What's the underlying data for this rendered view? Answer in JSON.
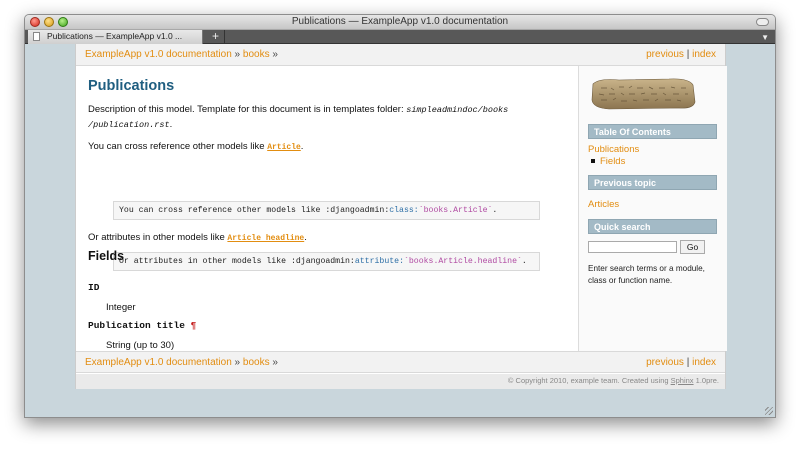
{
  "window": {
    "title": "Publications — ExampleApp v1.0 documentation"
  },
  "tab": {
    "label": "Publications — ExampleApp v1.0 ...",
    "new_tab": "+"
  },
  "relbar": {
    "home": "ExampleApp v1.0 documentation",
    "separator": "»",
    "section": "books",
    "previous": "previous",
    "pipe": "|",
    "index": "index"
  },
  "content": {
    "title": "Publications",
    "desc_text": "Description of this model. Template for this document is in templates folder: ",
    "desc_path_1": "simpleadmindoc/books",
    "desc_path_2": "/publication.rst",
    "desc_end": ".",
    "xref_text": "You can cross reference other models like ",
    "xref_link": "Article",
    "xref_end": ".",
    "code1_prefix": "You can cross reference other models like :djangoadmin:",
    "code1_role": "class:",
    "code1_literal": "`books.Article`",
    "code1_end": ".",
    "attr_text": "Or attributes in other models like ",
    "attr_link": "Article headline",
    "attr_end": ".",
    "code2_prefix": "Or attributes in other models like :djangoadmin:",
    "code2_role": "attribute:",
    "code2_literal": "`books.Article.headline`",
    "code2_end": ".",
    "fields_heading": "Fields",
    "fields": [
      {
        "name": "ID",
        "type": "Integer"
      },
      {
        "name": "Publication title",
        "type": "String (up to 30)",
        "anchor": "¶"
      }
    ]
  },
  "sidebar": {
    "toc_heading": "Table Of Contents",
    "toc_items": [
      "Publications",
      "Fields"
    ],
    "prev_heading": "Previous topic",
    "prev_link": "Articles",
    "search_heading": "Quick search",
    "search_value": "",
    "search_button": "Go",
    "search_help": "Enter search terms or a module, class or function name."
  },
  "footer": {
    "text": "© Copyright 2010, example team. Created using ",
    "sphinx": "Sphinx",
    "version": " 1.0pre."
  }
}
